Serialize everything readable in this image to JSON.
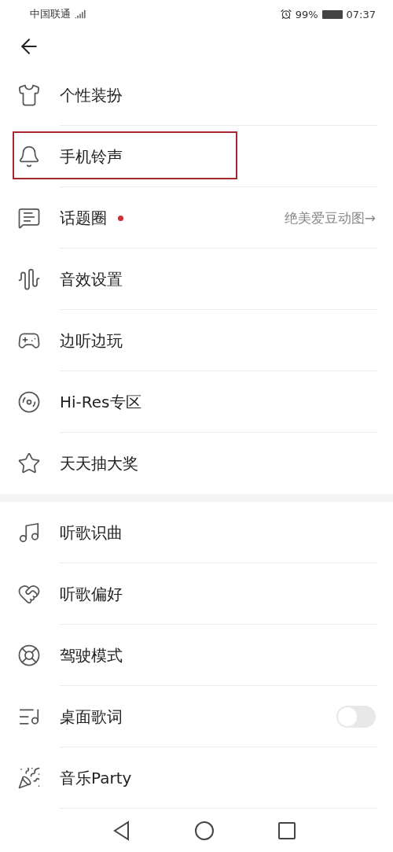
{
  "status_bar": {
    "carrier": "中国联通",
    "battery": "99%",
    "time": "07:37"
  },
  "groups": [
    {
      "items": [
        {
          "kind": "link",
          "label": "个性装扮"
        },
        {
          "kind": "link",
          "label": "手机铃声",
          "highlighted": true
        },
        {
          "kind": "link",
          "label": "话题圈",
          "dot": true,
          "trailing": "绝美爱豆动图→"
        },
        {
          "kind": "link",
          "label": "音效设置"
        },
        {
          "kind": "link",
          "label": "边听边玩"
        },
        {
          "kind": "link",
          "label": "Hi-Res专区"
        },
        {
          "kind": "link",
          "label": "天天抽大奖"
        }
      ]
    },
    {
      "items": [
        {
          "kind": "link",
          "label": "听歌识曲"
        },
        {
          "kind": "link",
          "label": "听歌偏好"
        },
        {
          "kind": "link",
          "label": "驾驶模式"
        },
        {
          "kind": "toggle",
          "label": "桌面歌词",
          "on": false
        },
        {
          "kind": "link",
          "label": "音乐Party"
        }
      ]
    }
  ]
}
